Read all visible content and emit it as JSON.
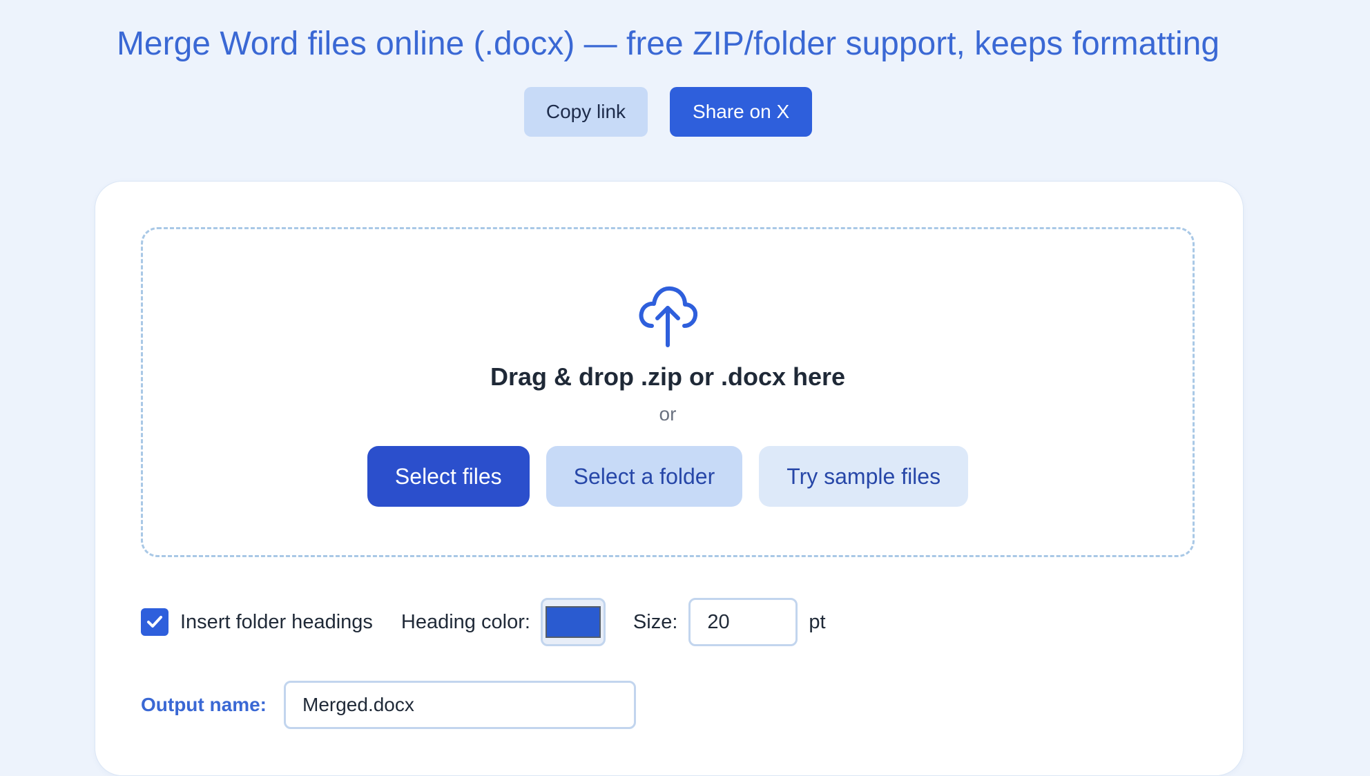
{
  "header": {
    "title": "Merge Word files online (.docx) — free ZIP/folder support, keeps formatting",
    "copy_link_label": "Copy link",
    "share_label": "Share on X"
  },
  "dropzone": {
    "icon": "cloud-upload-icon",
    "title": "Drag & drop .zip or .docx here",
    "or_text": "or",
    "select_files_label": "Select files",
    "select_folder_label": "Select a folder",
    "sample_label": "Try sample files"
  },
  "options": {
    "insert_headings_label": "Insert folder headings",
    "insert_headings_checked": true,
    "heading_color_label": "Heading color:",
    "heading_color_value": "#2a5bd0",
    "size_label": "Size:",
    "size_value": "20",
    "size_unit": "pt"
  },
  "output": {
    "label": "Output name:",
    "value": "Merged.docx"
  },
  "colors": {
    "accent": "#2e5fdc",
    "title": "#3a68d4",
    "background": "#edf3fc"
  }
}
